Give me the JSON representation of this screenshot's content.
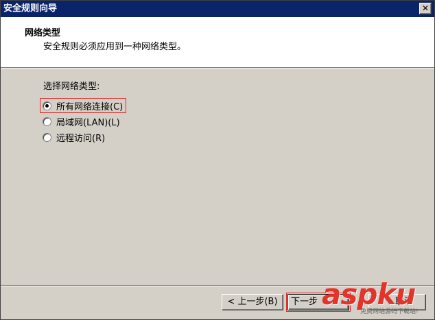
{
  "window": {
    "title": "安全规则向导",
    "close_glyph": "✕"
  },
  "header": {
    "title": "网络类型",
    "subtitle": "安全规则必须应用到一种网络类型。"
  },
  "body": {
    "prompt": "选择网络类型:",
    "options": [
      {
        "label": "所有网络连接(C)",
        "checked": true
      },
      {
        "label": "局域网(LAN)(L)",
        "checked": false
      },
      {
        "label": "远程访问(R)",
        "checked": false
      }
    ]
  },
  "buttons": {
    "back": "< 上一步(B)",
    "next": "下一步",
    "cancel": "取消"
  },
  "watermark": {
    "brand": "aspku",
    "tagline": "免费网站源码下载站!"
  },
  "colors": {
    "titlebar": "#0a246a",
    "highlight": "#e0282a",
    "face": "#d4d0c8"
  }
}
